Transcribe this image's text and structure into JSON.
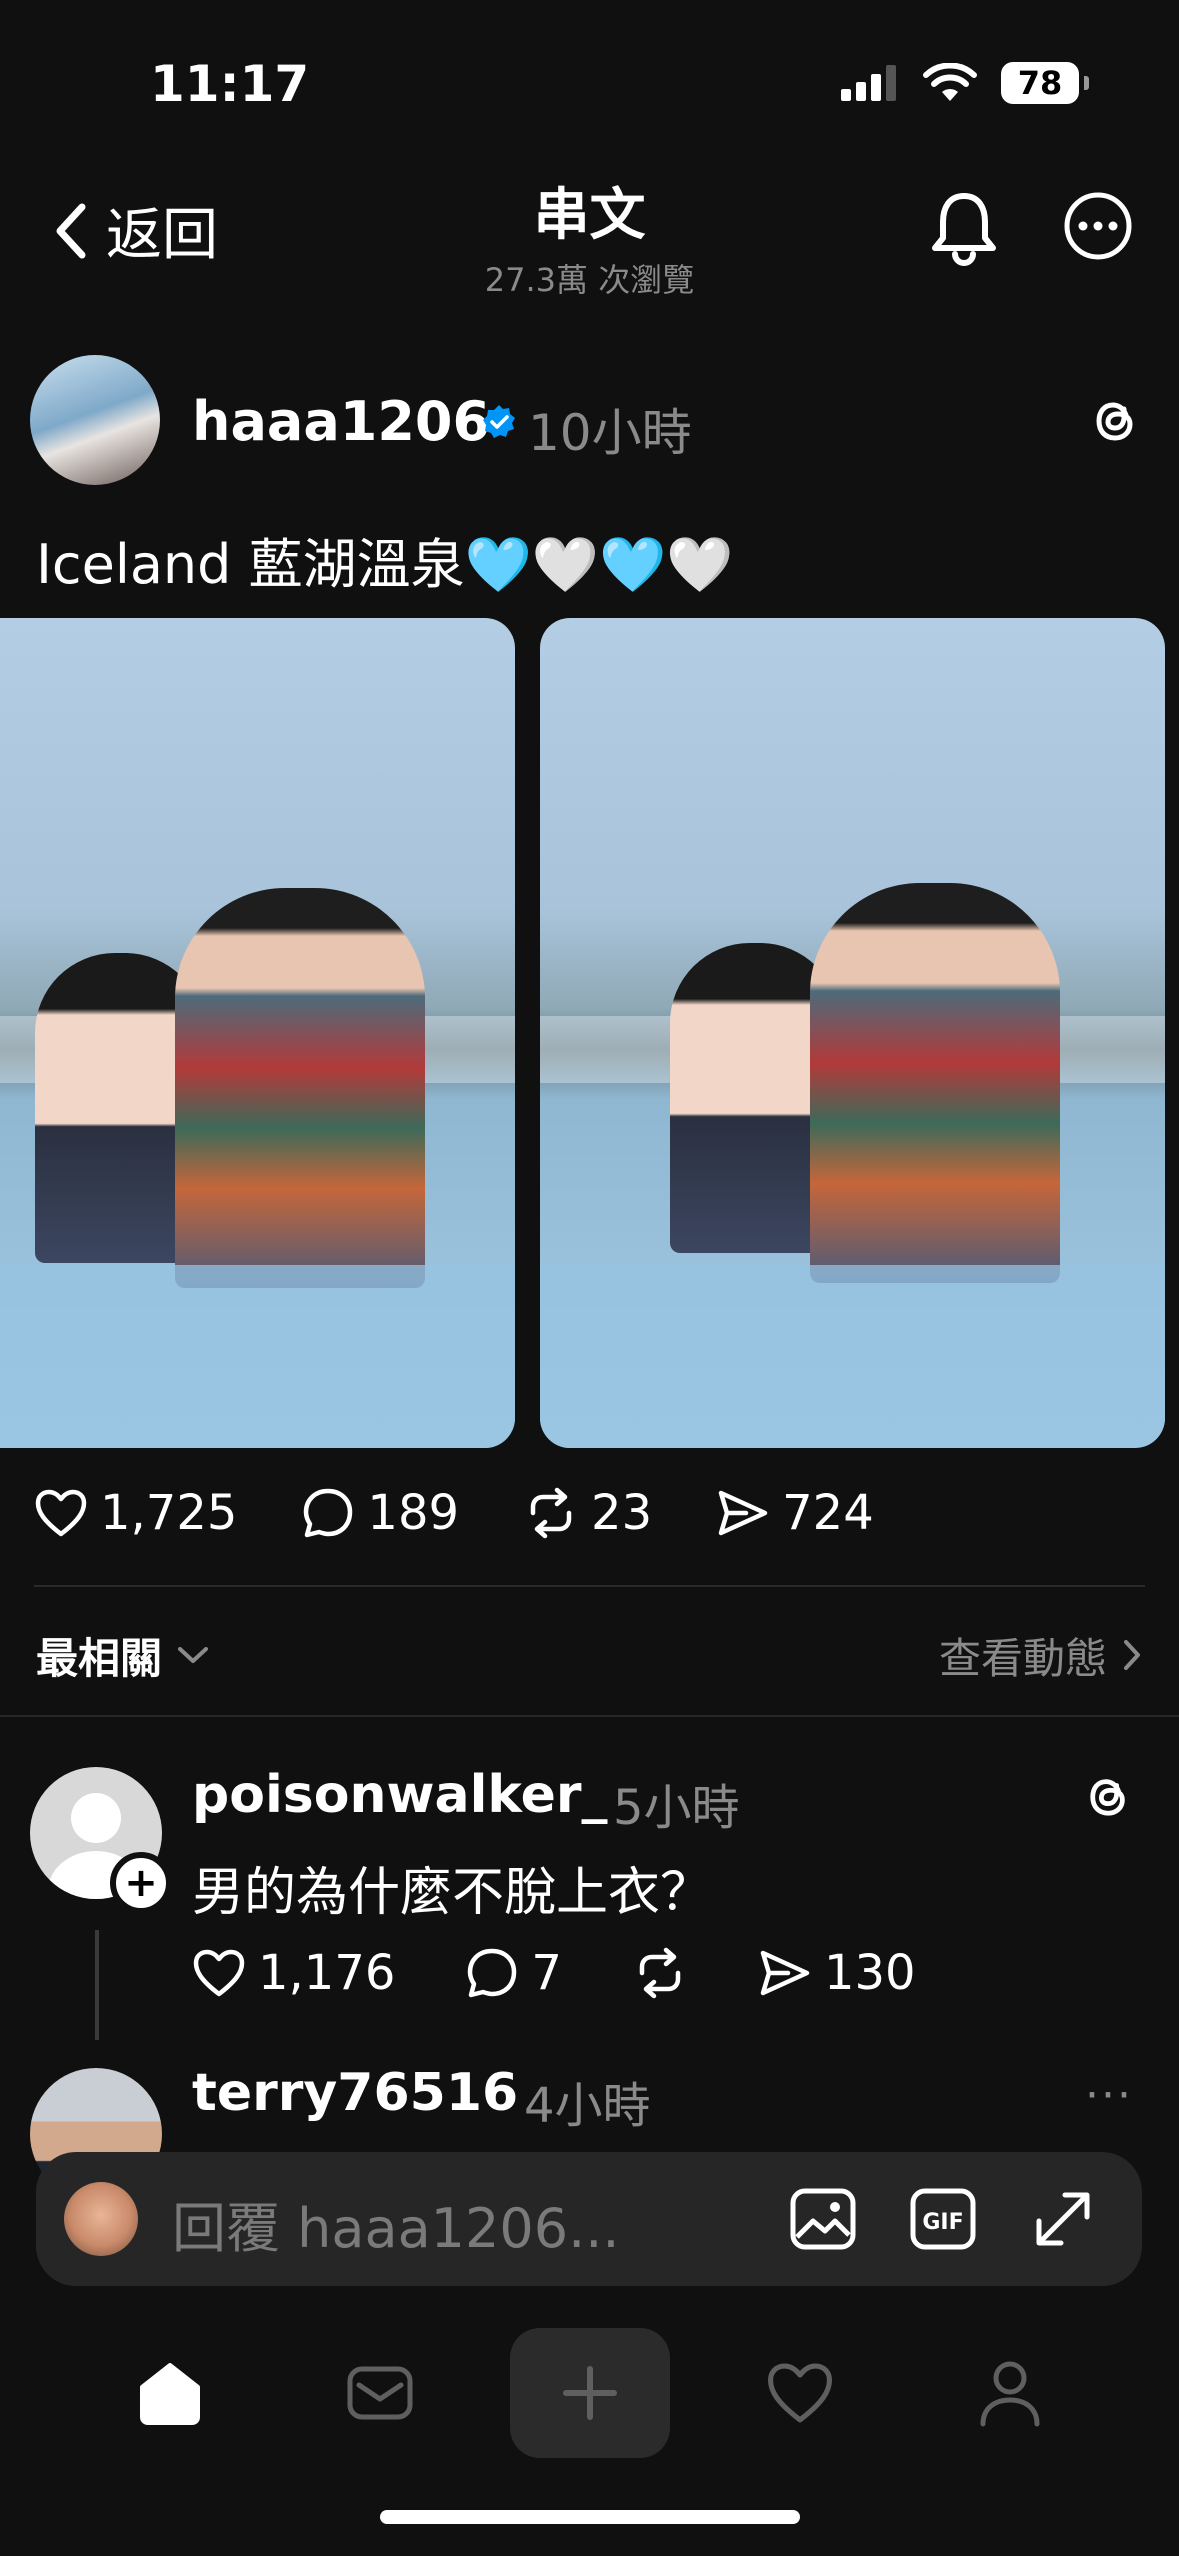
{
  "status_bar": {
    "time": "11:17",
    "battery": "78"
  },
  "header": {
    "back_label": "返回",
    "title": "串文",
    "views": "27.3萬 次瀏覽"
  },
  "post": {
    "username": "haaa1206",
    "time": "10小時",
    "caption": "Iceland 藍湖溫泉🩵🤍🩵🤍",
    "likes": "1,725",
    "comments": "189",
    "reposts": "23",
    "shares": "724"
  },
  "sort": {
    "label": "最相關",
    "activity_link": "查看動態"
  },
  "replies": [
    {
      "username": "poisonwalker_",
      "time": "5小時",
      "text": "男的為什麼不脫上衣？",
      "likes": "1,176",
      "comments": "7",
      "shares": "130"
    },
    {
      "username": "terry76516",
      "time": "4小時",
      "more": "···"
    }
  ],
  "reply_bar": {
    "placeholder": "回覆 haaa1206..."
  },
  "colors": {
    "background": "#101010",
    "verified": "#0095f6",
    "muted": "#8a8a8a"
  }
}
